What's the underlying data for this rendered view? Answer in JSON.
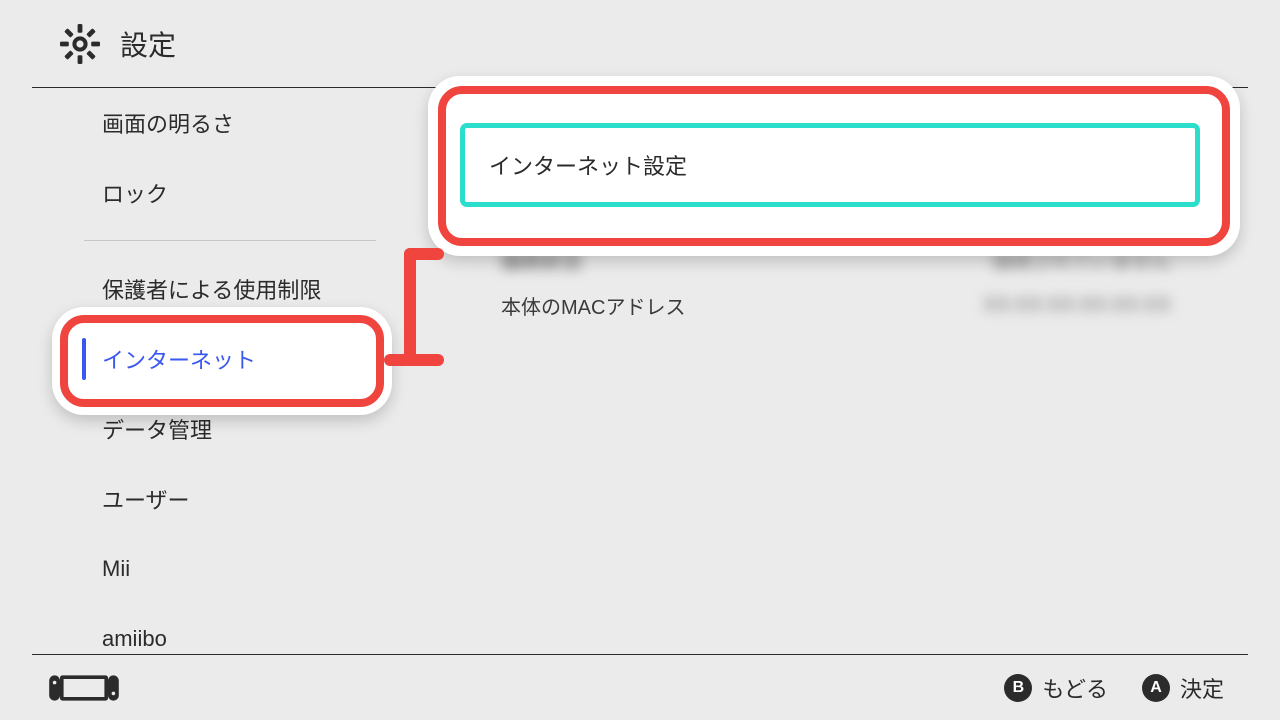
{
  "header": {
    "title": "設定"
  },
  "sidebar": {
    "items": [
      {
        "label": "画面の明るさ"
      },
      {
        "label": "ロック"
      },
      {
        "label": "保護者による使用制限"
      },
      {
        "label": "インターネット",
        "selected": true
      },
      {
        "label": "データ管理"
      },
      {
        "label": "ユーザー"
      },
      {
        "label": "Mii"
      },
      {
        "label": "amiibo"
      }
    ]
  },
  "main": {
    "internet_settings_label": "インターネット設定",
    "connection_status_label": "接続状況",
    "connection_status_value": "接続されていません",
    "mac_address_label": "本体のMACアドレス"
  },
  "footer": {
    "back_label": "もどる",
    "confirm_label": "決定",
    "back_button": "B",
    "confirm_button": "A"
  }
}
